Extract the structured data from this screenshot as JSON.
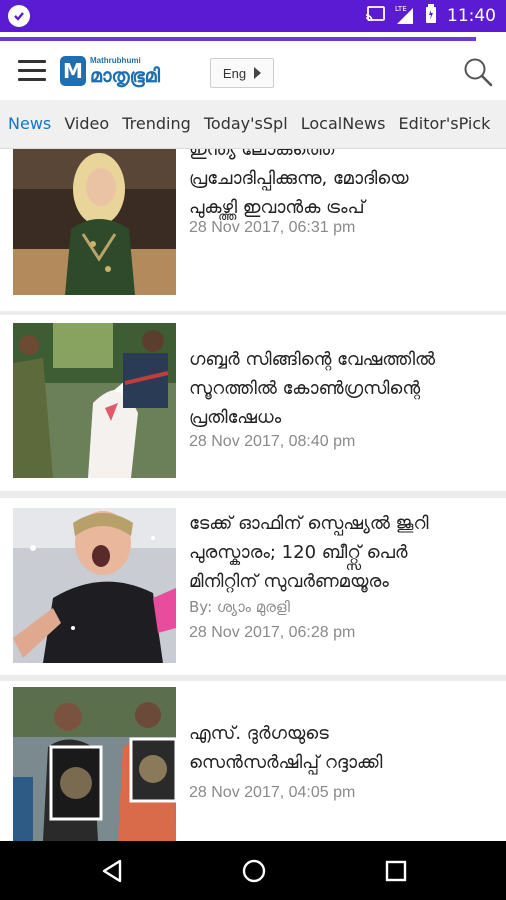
{
  "status_bar": {
    "time": "11:40",
    "icons": [
      "cast-icon",
      "lte-signal-icon",
      "battery-icon"
    ],
    "lte_label": "LTE",
    "background_color": "#5b1bd3"
  },
  "loading_progress": 0.94,
  "app_bar": {
    "logo_letter": "M",
    "logo_subtitle": "Mathrubhumi",
    "logo_name": "മാതൃഭൂമി",
    "language_button": "Eng",
    "brand_color": "#1e6fb2"
  },
  "tabs": [
    {
      "label": "News",
      "active": true
    },
    {
      "label": "Video",
      "active": false
    },
    {
      "label": "Trending",
      "active": false
    },
    {
      "label": "Today'sSpl",
      "active": false
    },
    {
      "label": "LocalNews",
      "active": false
    },
    {
      "label": "Editor'sPick",
      "active": false
    }
  ],
  "active_tab_color": "#1a73c6",
  "articles": [
    {
      "headline_lines": [
        "ഇന്ത്യ ലോകത്തെ",
        "പ്രചോദിപ്പിക്കുന്നു, മോദിയെ",
        "പുകഴ്ത്തി ഇവാൻക ട്രംപ്"
      ],
      "byline": "",
      "date": "28 Nov 2017, 06:31 pm"
    },
    {
      "headline_lines": [
        "ഗബ്ബർ സിങ്ങിന്റെ വേഷത്തിൽ",
        "സൂറത്തിൽ കോൺഗ്രസിന്റെ",
        "പ്രതിഷേധം"
      ],
      "byline": "",
      "date": "28 Nov 2017, 08:40 pm"
    },
    {
      "headline_lines": [
        "ടേക്ക് ഓഫിന് സ്പെഷ്യൽ ജൂറി",
        "പുരസ്കാരം; 120 ബീറ്റ്സ് പെർ",
        "മിനിറ്റിന് സുവർണമയൂരം"
      ],
      "byline": "By: ശ്യാം മുരളി",
      "date": "28 Nov 2017, 06:28 pm"
    },
    {
      "headline_lines": [
        "എസ്. ദുർഗയുടെ",
        "സെൻസർഷിപ്പ് റദ്ദാക്കി"
      ],
      "byline": "",
      "date": "28 Nov 2017, 04:05 pm"
    }
  ],
  "thumbnail_icons": [
    "woman-portrait-image",
    "protest-horse-image",
    "cheering-man-image",
    "poster-protest-image"
  ],
  "nav_bar": {
    "buttons": [
      "back-icon",
      "home-icon",
      "recents-icon"
    ]
  }
}
